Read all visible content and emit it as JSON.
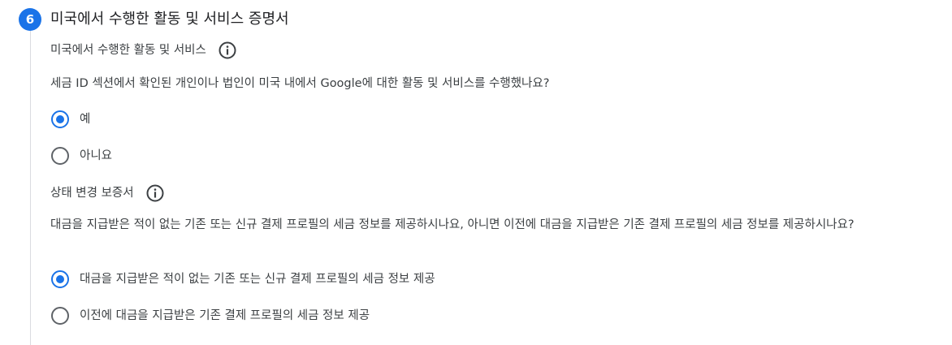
{
  "section": {
    "step_number": "6",
    "title": "미국에서 수행한 활동 및 서비스 증명서"
  },
  "us_activities": {
    "label": "미국에서 수행한 활동 및 서비스",
    "question": "세금 ID 섹션에서 확인된 개인이나 법인이 미국 내에서 Google에 대한 활동 및 서비스를 수행했나요?",
    "options": [
      {
        "label": "예",
        "selected": true
      },
      {
        "label": "아니요",
        "selected": false
      }
    ]
  },
  "status_change": {
    "label": "상태 변경 보증서",
    "question": "대금을 지급받은 적이 없는 기존 또는 신규 결제 프로필의 세금 정보를 제공하시나요, 아니면 이전에 대금을 지급받은 기존 결제 프로필의 세금 정보를 제공하시나요?",
    "options": [
      {
        "label": "대금을 지급받은 적이 없는 기존 또는 신규 결제 프로필의 세금 정보 제공",
        "selected": true
      },
      {
        "label": "이전에 대금을 지급받은 기존 결제 프로필의 세금 정보 제공",
        "selected": false
      }
    ]
  },
  "colors": {
    "accent": "#1a73e8",
    "text": "#3c4043",
    "radio_unselected": "#5f6368",
    "divider": "#dadce0"
  },
  "icons": {
    "info": "info-icon",
    "radio_checked": "radio-checked-icon",
    "radio_unchecked": "radio-unchecked-icon"
  }
}
